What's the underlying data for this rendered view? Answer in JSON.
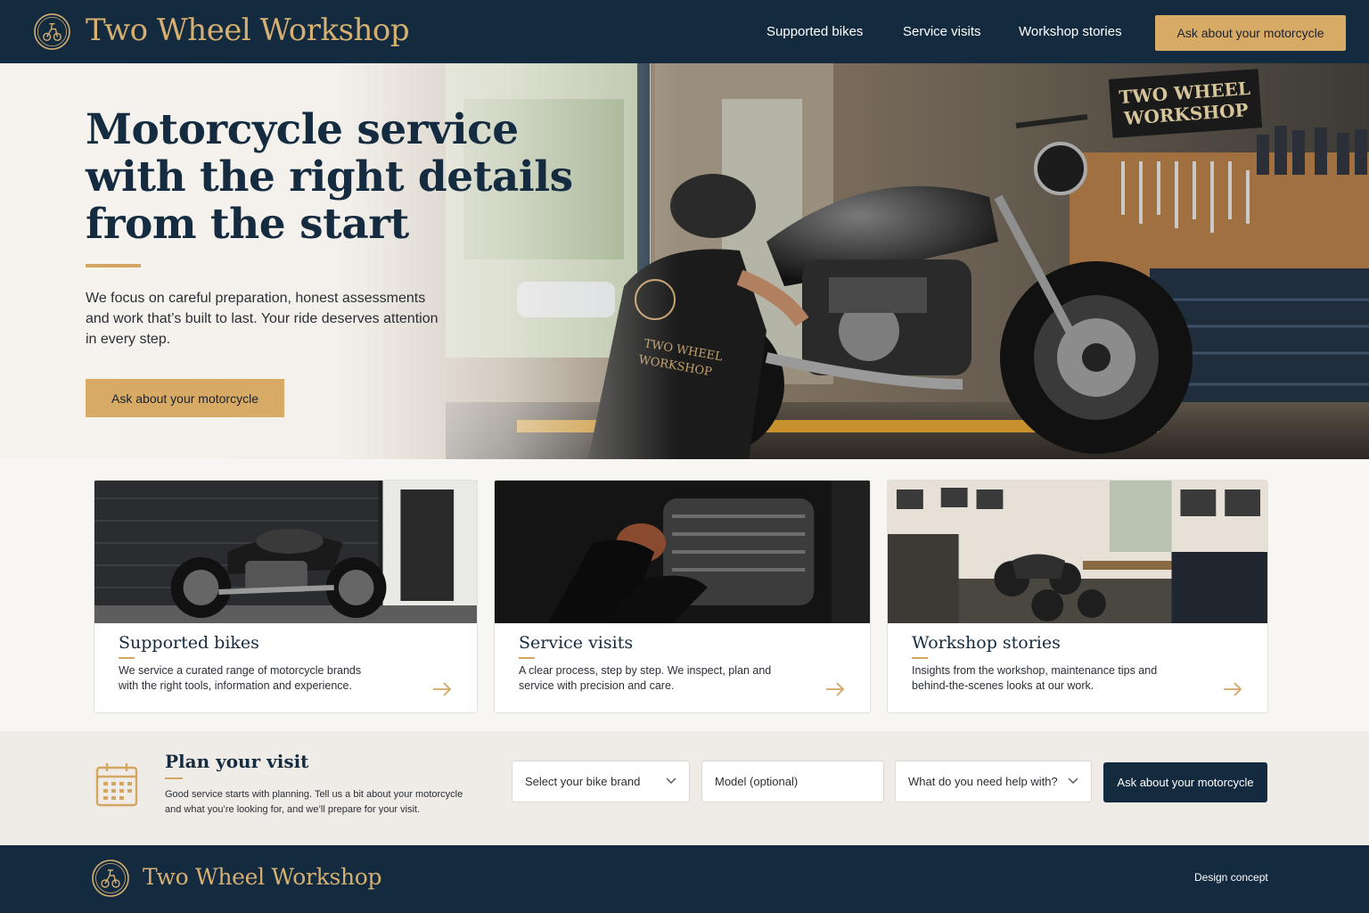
{
  "header": {
    "brand": "Two Wheel Workshop",
    "nav": [
      "Supported bikes",
      "Service visits",
      "Workshop stories"
    ],
    "cta_label": "Ask about your motorcycle"
  },
  "hero": {
    "title": "Motorcycle service with the right details from the start",
    "body": "We focus on careful preparation, honest assessments and work that’s built to last. Your ride deserves attention in every step.",
    "cta_label": "Ask about your motorcycle",
    "sign_text": [
      "TWO WHEEL",
      "WORKSHOP"
    ],
    "shirt_text": [
      "TWO WHEEL",
      "WORKSHOP"
    ]
  },
  "cards": [
    {
      "title": "Supported bikes",
      "text": "We service a curated range of motorcycle brands with the right tools, information and experience.",
      "arrow_icon": "arrow-right-icon"
    },
    {
      "title": "Service visits",
      "text": "A clear process, step by step. We inspect, plan and service with precision and care.",
      "arrow_icon": "arrow-right-icon"
    },
    {
      "title": "Workshop stories",
      "text": "Insights from the workshop, maintenance tips and behind-the-scenes looks at our work.",
      "arrow_icon": "arrow-right-icon"
    }
  ],
  "plan": {
    "title": "Plan your visit",
    "text": "Good service starts with planning. Tell us a bit about your motorcycle and what you’re looking for, and we’ll prepare for your visit.",
    "brand_select": "Select your bike brand",
    "model_field": "Model (optional)",
    "help_select": "What do you need help with?",
    "cta_label": "Ask about your motorcycle",
    "icon": "calendar-icon"
  },
  "footer": {
    "brand": "Two Wheel Workshop",
    "note": "Design concept"
  },
  "colors": {
    "navy": "#132a3f",
    "gold": "#d7aa66",
    "background": "#f8f6f3"
  }
}
